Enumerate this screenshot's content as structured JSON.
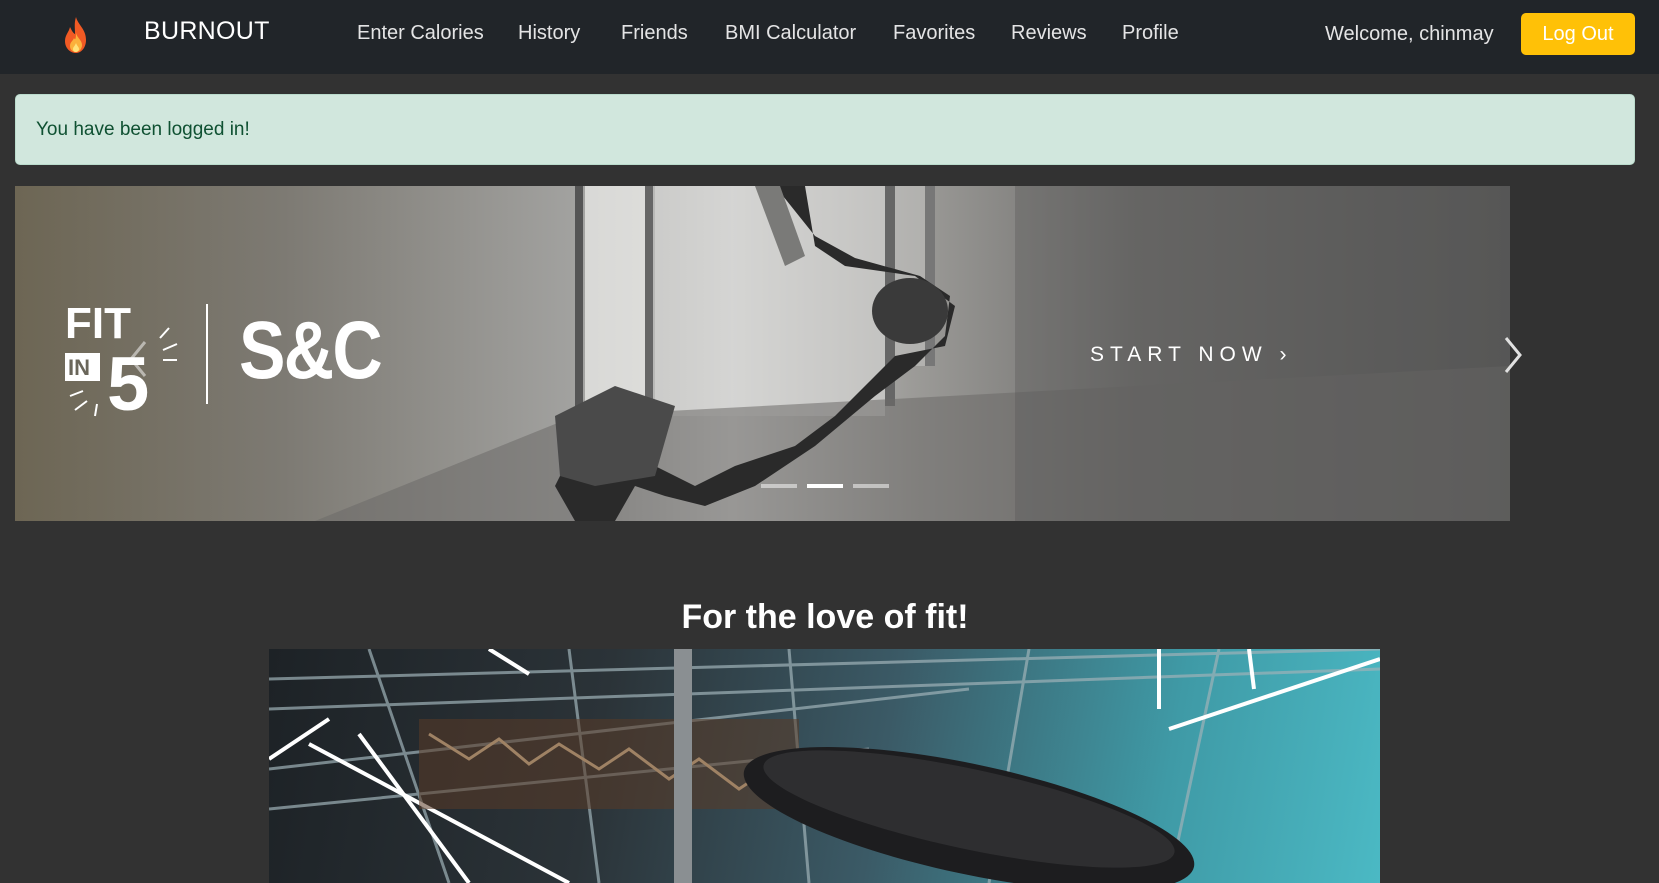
{
  "navbar": {
    "brand": "BURNOUT",
    "brand_icon": "flame-icon",
    "links": [
      "Enter Calories",
      "History",
      "Friends",
      "BMI Calculator",
      "Favorites",
      "Reviews",
      "Profile"
    ],
    "welcome": "Welcome, chinmay",
    "logout_label": "Log Out"
  },
  "alert": {
    "message": "You have been logged in!"
  },
  "carousel": {
    "logo_fit": "FIT",
    "logo_in": "IN",
    "logo_five": "5",
    "logo_sc": "S&C",
    "cta": "START NOW",
    "slide_count": 3,
    "active_slide": 2
  },
  "section": {
    "title": "For the love of fit!"
  },
  "colors": {
    "navbar_bg": "#212529",
    "page_bg": "#323232",
    "alert_bg": "#d1e7dd",
    "alert_text": "#0f5132",
    "logout_bg": "#ffc107"
  }
}
